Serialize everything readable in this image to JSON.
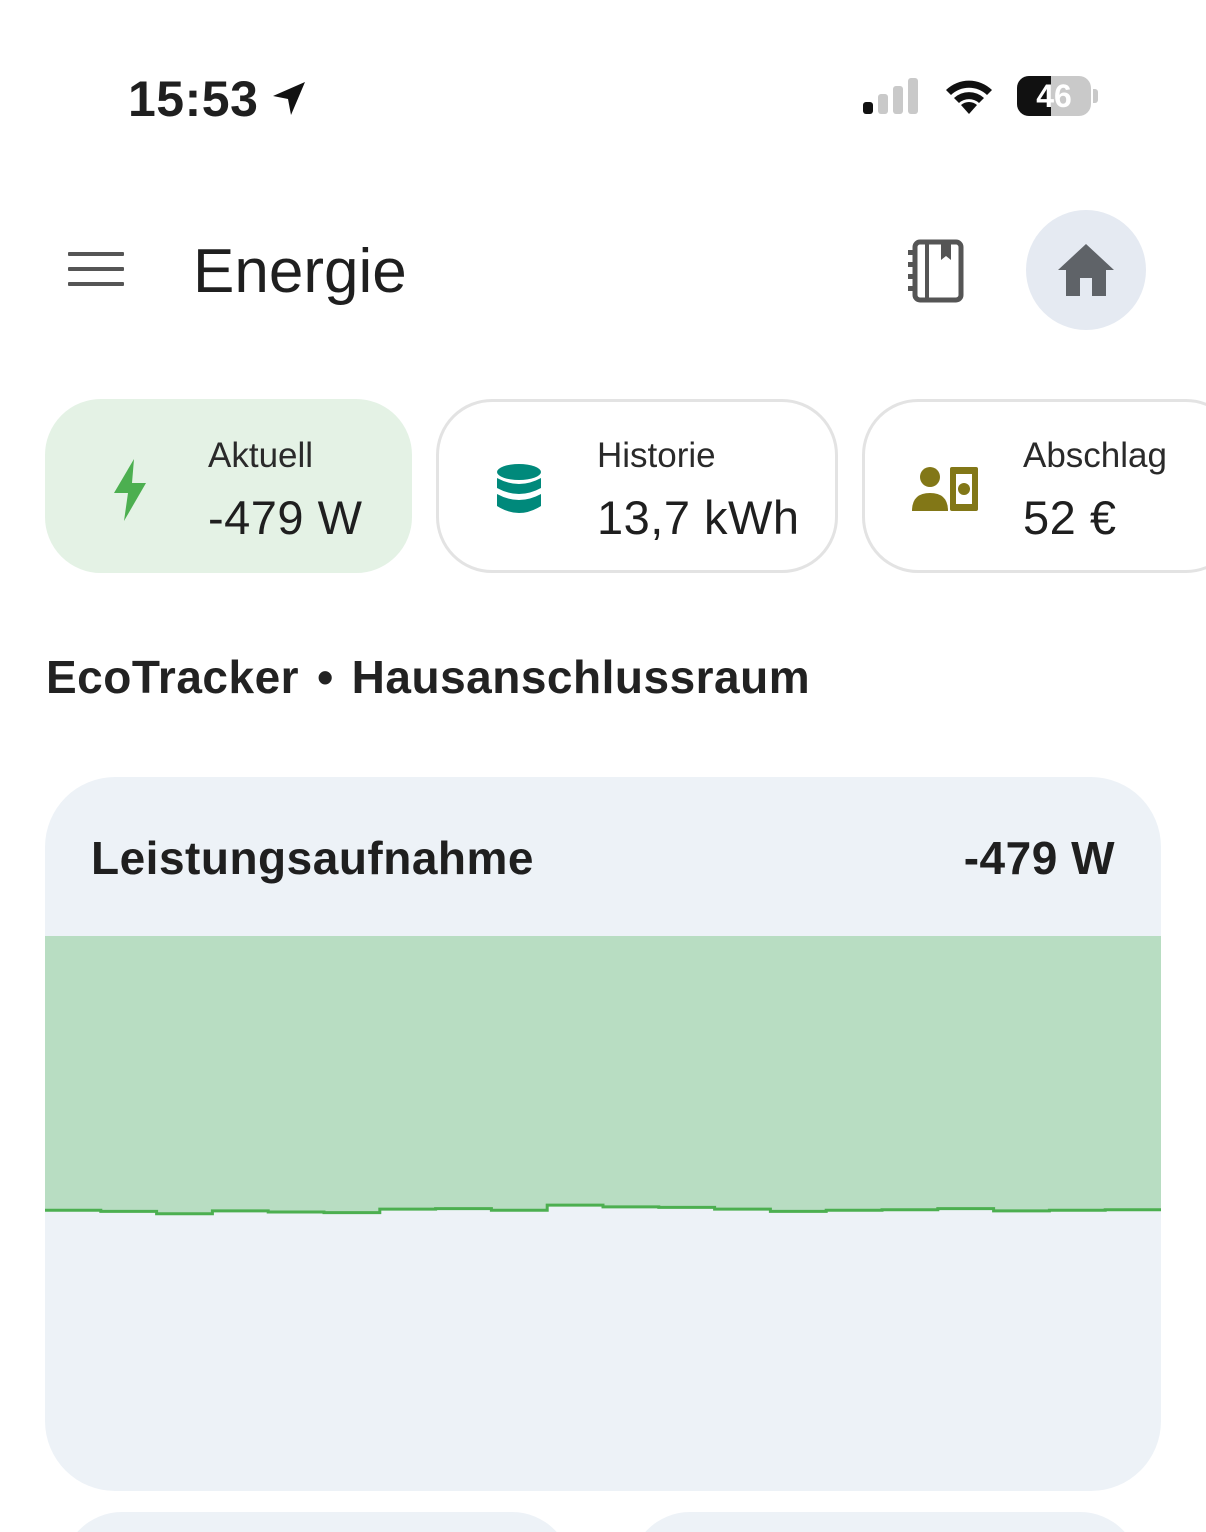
{
  "status_bar": {
    "time": "15:53",
    "battery": "46",
    "battery_level": 0.46,
    "icons": [
      "location-arrow-icon",
      "cellular-signal-icon",
      "wifi-icon",
      "battery-icon"
    ]
  },
  "app_bar": {
    "title": "Energie",
    "icons": [
      "menu-icon",
      "notebook-icon",
      "home-icon"
    ]
  },
  "chips": [
    {
      "label": "Aktuell",
      "value": "-479 W",
      "icon": "lightning-bolt-icon",
      "icon_color": "#4caf50",
      "active": true
    },
    {
      "label": "Historie",
      "value": "13,7 kWh",
      "icon": "database-icon",
      "icon_color": "#00897b",
      "active": false
    },
    {
      "label": "Abschlag",
      "value": "52 €",
      "icon": "contact-money-icon",
      "icon_color": "#827717",
      "active": false
    }
  ],
  "device": {
    "name": "EcoTracker",
    "separator": "•",
    "location": "Hausanschlussraum"
  },
  "power_card": {
    "title": "Leistungsaufnahme",
    "value": "-479 W",
    "colors": {
      "fill": "#b8ddc2",
      "line": "#4caf50",
      "card_background": "#edf2f7"
    }
  },
  "chart_data": {
    "type": "area",
    "title": "Leistungsaufnahme",
    "xlabel": "",
    "ylabel": "",
    "grid": false,
    "values": [
      -480,
      -482,
      -486,
      -481,
      -483,
      -484,
      -478,
      -477,
      -480,
      -471,
      -474,
      -475,
      -478,
      -482,
      -480,
      -479,
      -477,
      -481,
      -480,
      -479
    ],
    "ylim": [
      -700,
      0
    ]
  }
}
